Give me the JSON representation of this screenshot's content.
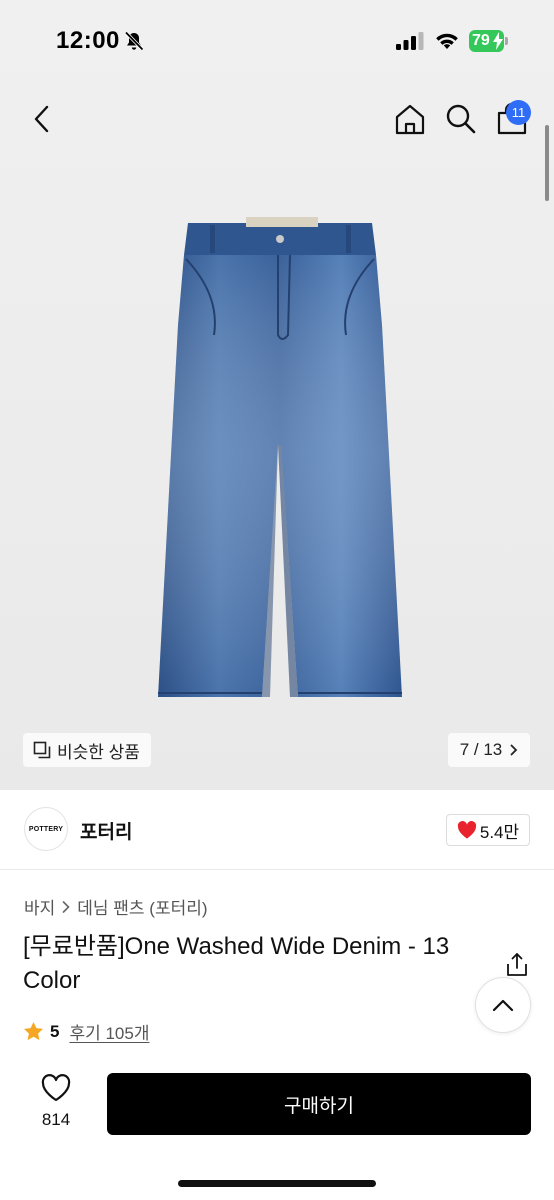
{
  "status_bar": {
    "time": "12:00",
    "battery": "79"
  },
  "header": {
    "cart_count": "11"
  },
  "gallery": {
    "similar_label": "비슷한 상품",
    "page_indicator": "7 / 13"
  },
  "brand": {
    "logo_text": "POTTERY",
    "name": "포터리",
    "likes": "5.4만"
  },
  "product": {
    "breadcrumb": [
      "바지",
      "데님 팬츠 (포터리)"
    ],
    "title": "[무료반품]One Washed Wide Denim - 13 Color",
    "rating": "5",
    "reviews": "후기 105개"
  },
  "bottom_bar": {
    "wish_count": "814",
    "buy_label": "구매하기"
  },
  "colors": {
    "accent_badge": "#2f6df6",
    "battery": "#34c759",
    "heart": "#e8232d",
    "star": "#f5a623",
    "buy_button": "#000000"
  },
  "icons": [
    "bell-slash-icon",
    "signal-icon",
    "wifi-icon",
    "back-icon",
    "home-icon",
    "search-icon",
    "cart-icon",
    "similar-icon",
    "chevron-right-icon",
    "heart-filled-icon",
    "share-icon",
    "chevron-up-icon",
    "star-icon",
    "heart-outline-icon"
  ]
}
